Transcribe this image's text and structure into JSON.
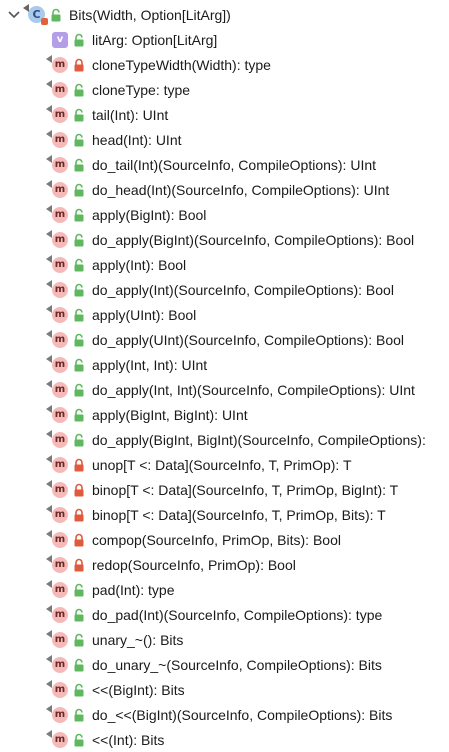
{
  "colors": {
    "method_badge": "#f5b9b8",
    "val_badge": "#b49ee8",
    "class_badge": "#a9c9ee",
    "public_lock": "#5fb85f",
    "private_lock": "#e05a3d"
  },
  "root": {
    "chevron_icon": "chevron-down-icon",
    "badge": "C",
    "visibility": "public",
    "label": "Bits(Width, Option[LitArg])"
  },
  "members": [
    {
      "badge": "v",
      "kind": "val",
      "visibility": "public",
      "label": "litArg: Option[LitArg]"
    },
    {
      "badge": "m",
      "kind": "method",
      "visibility": "private",
      "label": "cloneTypeWidth(Width): type"
    },
    {
      "badge": "m",
      "kind": "method",
      "visibility": "public",
      "label": "cloneType: type"
    },
    {
      "badge": "m",
      "kind": "method",
      "visibility": "public",
      "label": "tail(Int): UInt"
    },
    {
      "badge": "m",
      "kind": "method",
      "visibility": "public",
      "label": "head(Int): UInt"
    },
    {
      "badge": "m",
      "kind": "method",
      "visibility": "public",
      "label": "do_tail(Int)(SourceInfo, CompileOptions): UInt"
    },
    {
      "badge": "m",
      "kind": "method",
      "visibility": "public",
      "label": "do_head(Int)(SourceInfo, CompileOptions): UInt"
    },
    {
      "badge": "m",
      "kind": "method",
      "visibility": "public",
      "label": "apply(BigInt): Bool"
    },
    {
      "badge": "m",
      "kind": "method",
      "visibility": "public",
      "label": "do_apply(BigInt)(SourceInfo, CompileOptions): Bool"
    },
    {
      "badge": "m",
      "kind": "method",
      "visibility": "public",
      "label": "apply(Int): Bool"
    },
    {
      "badge": "m",
      "kind": "method",
      "visibility": "public",
      "label": "do_apply(Int)(SourceInfo, CompileOptions): Bool"
    },
    {
      "badge": "m",
      "kind": "method",
      "visibility": "public",
      "label": "apply(UInt): Bool"
    },
    {
      "badge": "m",
      "kind": "method",
      "visibility": "public",
      "label": "do_apply(UInt)(SourceInfo, CompileOptions): Bool"
    },
    {
      "badge": "m",
      "kind": "method",
      "visibility": "public",
      "label": "apply(Int, Int): UInt"
    },
    {
      "badge": "m",
      "kind": "method",
      "visibility": "public",
      "label": "do_apply(Int, Int)(SourceInfo, CompileOptions): UInt"
    },
    {
      "badge": "m",
      "kind": "method",
      "visibility": "public",
      "label": "apply(BigInt, BigInt): UInt"
    },
    {
      "badge": "m",
      "kind": "method",
      "visibility": "public",
      "label": "do_apply(BigInt, BigInt)(SourceInfo, CompileOptions):"
    },
    {
      "badge": "m",
      "kind": "method",
      "visibility": "private",
      "label": "unop[T <: Data](SourceInfo, T, PrimOp): T"
    },
    {
      "badge": "m",
      "kind": "method",
      "visibility": "private",
      "label": "binop[T <: Data](SourceInfo, T, PrimOp, BigInt): T"
    },
    {
      "badge": "m",
      "kind": "method",
      "visibility": "private",
      "label": "binop[T <: Data](SourceInfo, T, PrimOp, Bits): T"
    },
    {
      "badge": "m",
      "kind": "method",
      "visibility": "private",
      "label": "compop(SourceInfo, PrimOp, Bits): Bool"
    },
    {
      "badge": "m",
      "kind": "method",
      "visibility": "private",
      "label": "redop(SourceInfo, PrimOp): Bool"
    },
    {
      "badge": "m",
      "kind": "method",
      "visibility": "public",
      "label": "pad(Int): type"
    },
    {
      "badge": "m",
      "kind": "method",
      "visibility": "public",
      "label": "do_pad(Int)(SourceInfo, CompileOptions): type"
    },
    {
      "badge": "m",
      "kind": "method",
      "visibility": "public",
      "label": "unary_~(): Bits"
    },
    {
      "badge": "m",
      "kind": "method",
      "visibility": "public",
      "label": "do_unary_~(SourceInfo, CompileOptions): Bits"
    },
    {
      "badge": "m",
      "kind": "method",
      "visibility": "public",
      "label": "<<(BigInt): Bits"
    },
    {
      "badge": "m",
      "kind": "method",
      "visibility": "public",
      "label": "do_<<(BigInt)(SourceInfo, CompileOptions): Bits"
    },
    {
      "badge": "m",
      "kind": "method",
      "visibility": "public",
      "label": "<<(Int): Bits"
    }
  ]
}
